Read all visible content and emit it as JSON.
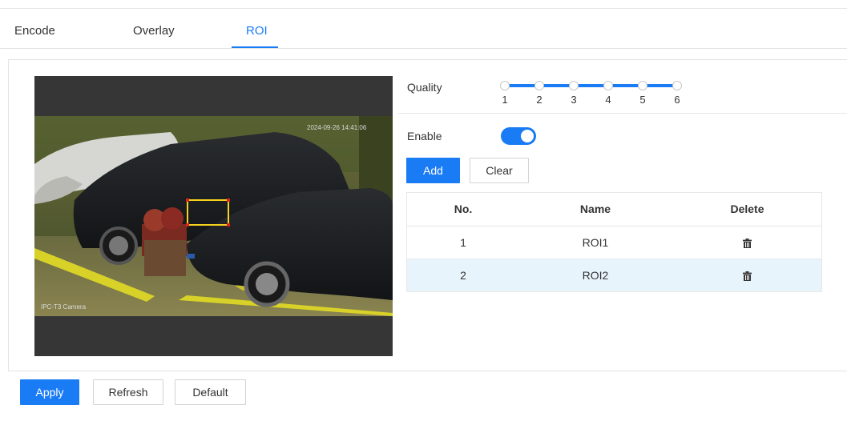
{
  "tabs": [
    {
      "label": "Encode",
      "active": false
    },
    {
      "label": "Overlay",
      "active": false
    },
    {
      "label": "ROI",
      "active": true
    }
  ],
  "video": {
    "osd_top_right": "2024-09-26 14:41:06",
    "osd_bottom_left": "IPC-T3 Camera"
  },
  "quality": {
    "label": "Quality",
    "levels": [
      "1",
      "2",
      "3",
      "4",
      "5",
      "6"
    ],
    "value": 6
  },
  "enable": {
    "label": "Enable",
    "on": true
  },
  "roi_actions": {
    "add_label": "Add",
    "clear_label": "Clear"
  },
  "roi_table": {
    "headers": [
      "No.",
      "Name",
      "Delete"
    ],
    "rows": [
      {
        "no": "1",
        "name": "ROI1",
        "selected": false
      },
      {
        "no": "2",
        "name": "ROI2",
        "selected": true
      }
    ]
  },
  "footer": {
    "apply_label": "Apply",
    "refresh_label": "Refresh",
    "default_label": "Default"
  },
  "colors": {
    "accent": "#1a7cf5",
    "selected_row": "#e8f4fc",
    "roi_box": "#f5d21e",
    "roi_handle": "#e02020"
  }
}
